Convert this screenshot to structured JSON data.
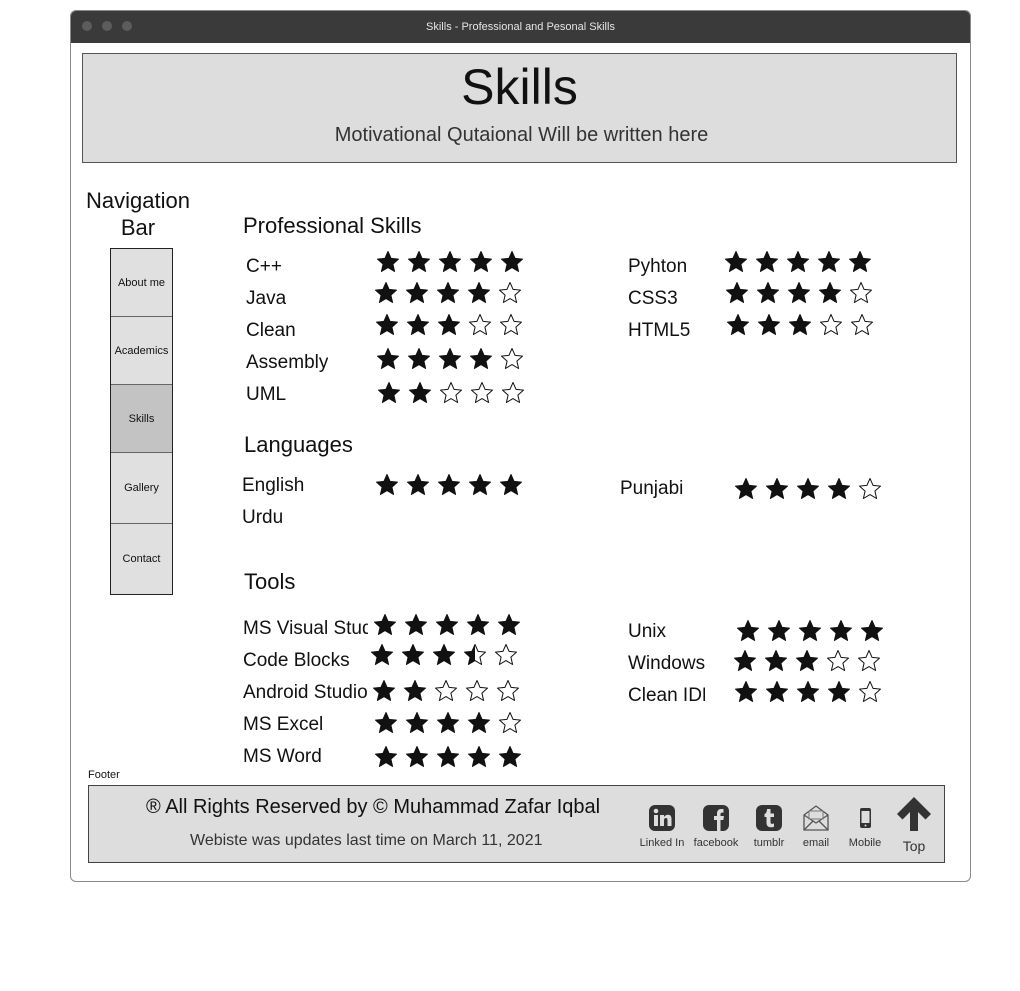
{
  "window": {
    "title": "Skills - Professional and Pesonal Skills"
  },
  "header": {
    "title": "Skills",
    "quote": "Motivational Qutaional Will be written here"
  },
  "nav": {
    "title": "Navigation Bar",
    "items": [
      {
        "label": "About me"
      },
      {
        "label": "Academics"
      },
      {
        "label": "Skills",
        "active": true
      },
      {
        "label": "Gallery"
      },
      {
        "label": "Contact"
      }
    ]
  },
  "sections": {
    "professional": {
      "title": "Professional Skills",
      "left": [
        {
          "name": "C++",
          "rating": 5
        },
        {
          "name": "Java",
          "rating": 4
        },
        {
          "name": "Clean",
          "rating": 3
        },
        {
          "name": "Assembly",
          "rating": 4
        },
        {
          "name": "UML",
          "rating": 2
        }
      ],
      "right": [
        {
          "name": "Pyhton",
          "rating": 5
        },
        {
          "name": "CSS3",
          "rating": 4
        },
        {
          "name": "HTML5",
          "rating": 3
        }
      ]
    },
    "languages": {
      "title": "Languages",
      "left": [
        {
          "name": "English",
          "rating": 5
        },
        {
          "name": "Urdu",
          "rating": null
        }
      ],
      "right": [
        {
          "name": "Punjabi",
          "rating": 4
        }
      ]
    },
    "tools": {
      "title": "Tools",
      "left": [
        {
          "name": "MS Visual Studio",
          "rating": 5
        },
        {
          "name": "Code Blocks",
          "rating": 3.5
        },
        {
          "name": "Android Studio",
          "rating": 2
        },
        {
          "name": "MS Excel",
          "rating": 4
        },
        {
          "name": "MS Word",
          "rating": 5
        }
      ],
      "right": [
        {
          "name": "Unix",
          "rating": 5
        },
        {
          "name": "Windows",
          "rating": 3
        },
        {
          "name": "Clean IDE",
          "rating": 4
        }
      ]
    }
  },
  "footer": {
    "caption": "Footer",
    "rights": "® All Rights Reserved by © Muhammad Zafar Iqbal",
    "updated": "Webiste was updates last time on March 11, 2021",
    "links": [
      {
        "label": "Linked In",
        "icon": "linkedin-icon"
      },
      {
        "label": "facebook",
        "icon": "facebook-icon"
      },
      {
        "label": "tumblr",
        "icon": "tumblr-icon"
      },
      {
        "label": "email",
        "icon": "email-icon"
      },
      {
        "label": "Mobile",
        "icon": "mobile-icon"
      }
    ],
    "top_label": "Top"
  }
}
